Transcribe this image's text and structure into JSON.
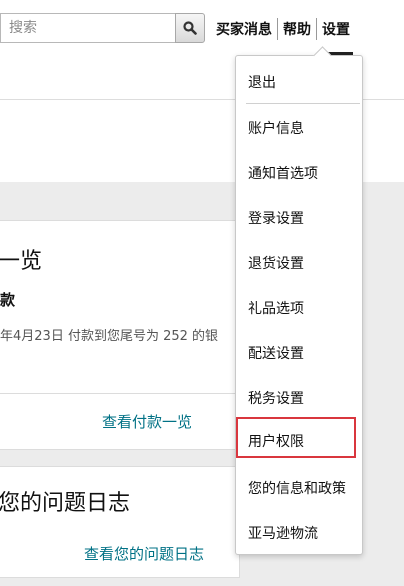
{
  "search": {
    "placeholder": "搜索"
  },
  "topnav": {
    "buyer_messages": "买家消息",
    "help": "帮助",
    "settings": "设置"
  },
  "cards": [
    {
      "title": "一览",
      "subtitle": "款",
      "description": "年4月23日 付款到您尾号为 252 的银",
      "link": "查看付款一览"
    },
    {
      "title": "您的问题日志",
      "link": "查看您的问题日志"
    }
  ],
  "settings_menu": {
    "items": [
      "退出",
      "账户信息",
      "通知首选项",
      "登录设置",
      "退货设置",
      "礼品选项",
      "配送设置",
      "税务设置",
      "用户权限",
      "您的信息和政策",
      "亚马逊物流"
    ],
    "highlighted_item": "用户权限"
  },
  "colors": {
    "link": "#007185",
    "highlight_border": "#d9363e",
    "background_gray": "#ececec"
  },
  "icons": {
    "search_button": "magnifier-icon"
  }
}
